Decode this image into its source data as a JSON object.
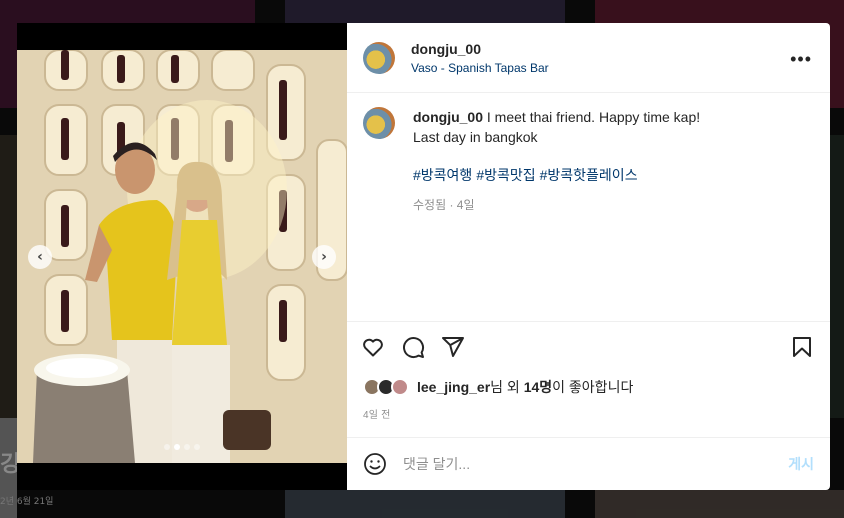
{
  "background": {
    "left_big_text": "깅",
    "left_date": "2년 6월 21일"
  },
  "post": {
    "username": "dongju_00",
    "location": "Vaso - Spanish Tapas Bar",
    "caption_user": "dongju_00",
    "caption_line1": "I meet thai friend. Happy time kap!",
    "caption_line2": "Last day in bangkok",
    "hashtags": [
      "#방콕여행",
      "#방콕맛집",
      "#방콕핫플레이스"
    ],
    "caption_meta": "수정됨 · 4일",
    "likes_user": "lee_jing_er",
    "likes_suffix1": "님 외 ",
    "likes_count": "14명",
    "likes_suffix2": "이 좋아합니다",
    "time_ago": "4일 전",
    "comment_placeholder": "댓글 달기...",
    "post_button": "게시",
    "carousel_dots": 4,
    "carousel_active": 1
  },
  "icons": {
    "more": "more-options-icon",
    "like": "heart-icon",
    "comment": "comment-icon",
    "share": "share-icon",
    "save": "bookmark-icon",
    "emoji": "emoji-icon",
    "prev": "chevron-left-icon",
    "next": "chevron-right-icon"
  },
  "colors": {
    "link": "#00376b",
    "muted": "#8e8e8e",
    "post_disabled": "#b2dffc"
  }
}
